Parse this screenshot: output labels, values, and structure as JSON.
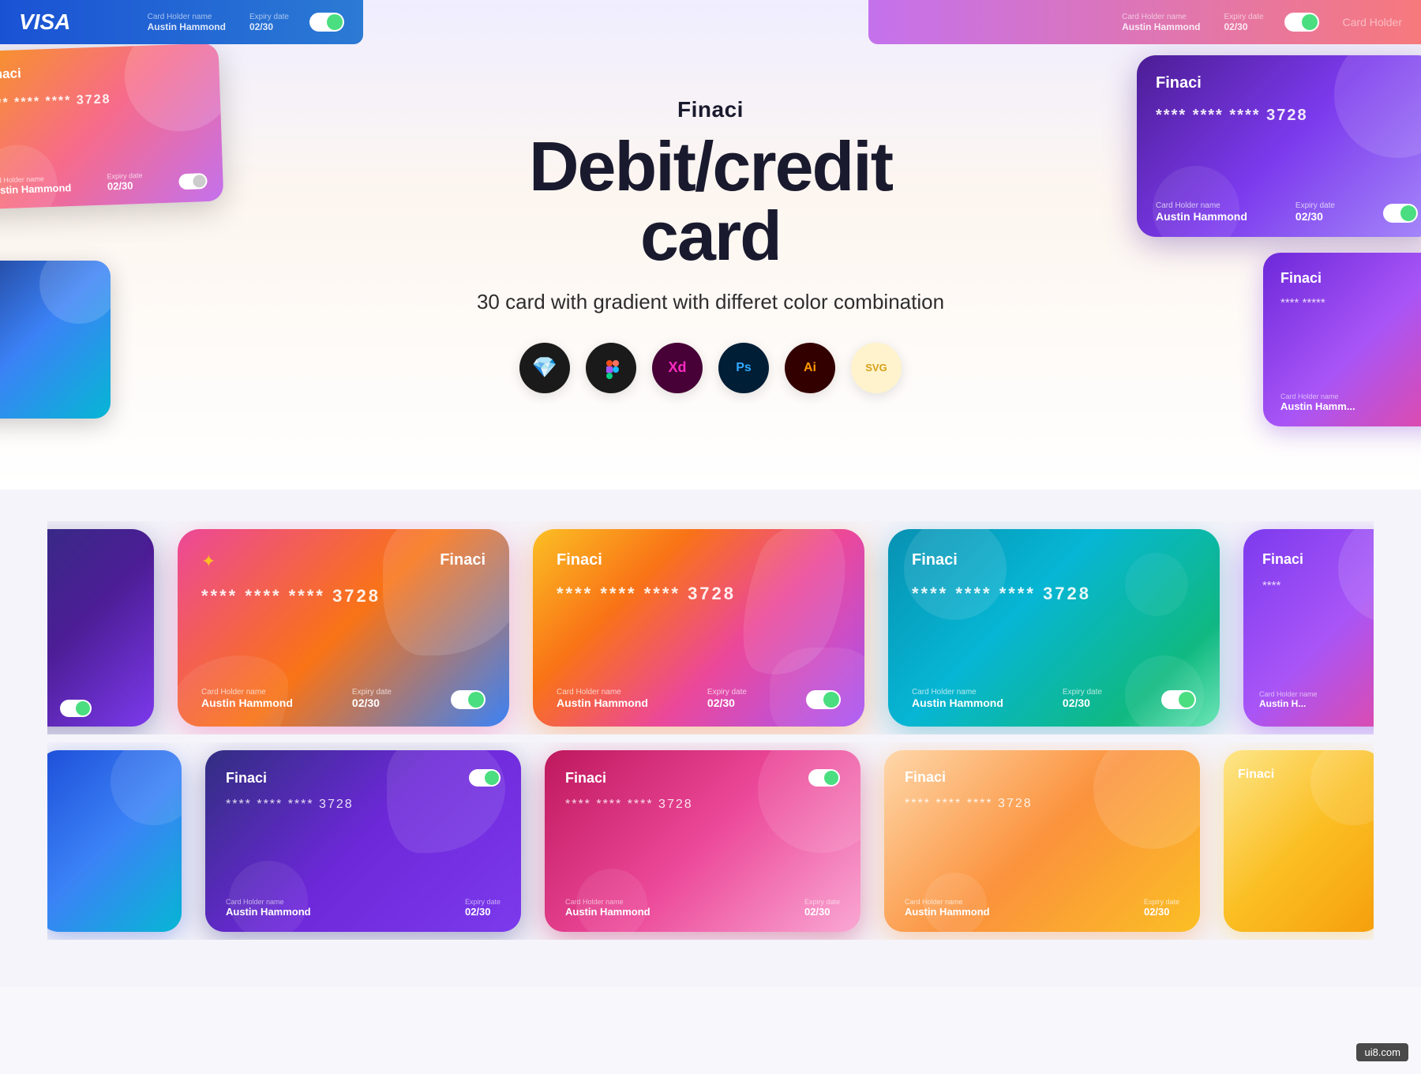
{
  "hero": {
    "brand": "Finaci",
    "title": "Debit/credit\ncard",
    "subtitle": "30 card with gradient with differet color combination"
  },
  "tools": [
    {
      "name": "sketch",
      "icon": "💎"
    },
    {
      "name": "figma",
      "icon": "🎨"
    },
    {
      "name": "xd",
      "icon": "🟣"
    },
    {
      "name": "photoshop",
      "icon": "🟦"
    },
    {
      "name": "illustrator",
      "icon": "🟧"
    },
    {
      "name": "svg",
      "icon": "📄"
    }
  ],
  "cards": {
    "brand": "Finaci",
    "number_masked": "**** **** **** 3728",
    "holder_label": "Card Holder name",
    "holder_name": "Austin Hammond",
    "expiry_label": "Expiry date",
    "expiry_value": "02/30"
  },
  "watermark": "ui8.com"
}
